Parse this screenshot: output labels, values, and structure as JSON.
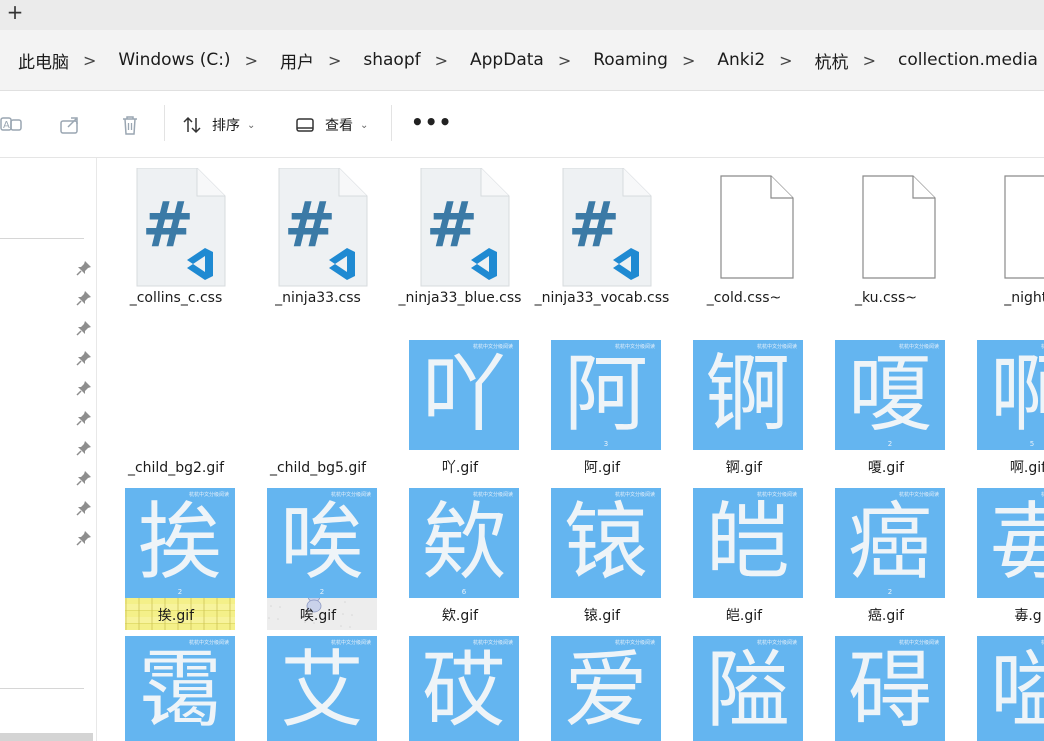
{
  "tabstrip": {
    "new_tab_glyph": "+"
  },
  "breadcrumb": [
    "此电脑",
    "Windows (C:)",
    "用户",
    "shaopf",
    "AppData",
    "Roaming",
    "Anki2",
    "杭杭",
    "collection.media"
  ],
  "breadcrumb_separator": ">",
  "toolbar": {
    "sort_label": "排序",
    "view_label": "查看",
    "more_label": "•••",
    "chevron": "⌄"
  },
  "files": [
    {
      "name": "_collins_c.css",
      "kind": "css-vscode"
    },
    {
      "name": "_ninja33.css",
      "kind": "css-vscode"
    },
    {
      "name": "_ninja33_blue.css",
      "kind": "css-vscode"
    },
    {
      "name": "_ninja33_vocab.css",
      "kind": "css-vscode"
    },
    {
      "name": "_cold.css~",
      "kind": "blank"
    },
    {
      "name": "_ku.css~",
      "kind": "blank"
    },
    {
      "name": "_night.",
      "kind": "blank"
    },
    {
      "name": "_child_bg2.gif",
      "kind": "bg-yellow"
    },
    {
      "name": "_child_bg5.gif",
      "kind": "bg-grey"
    },
    {
      "name": "吖.gif",
      "kind": "gif",
      "glyph": "吖",
      "stroke": ""
    },
    {
      "name": "阿.gif",
      "kind": "gif",
      "glyph": "阿",
      "stroke": "3"
    },
    {
      "name": "锕.gif",
      "kind": "gif",
      "glyph": "锕",
      "stroke": ""
    },
    {
      "name": "嗄.gif",
      "kind": "gif",
      "glyph": "嗄",
      "stroke": "2"
    },
    {
      "name": "啊.gif",
      "kind": "gif",
      "glyph": "啊",
      "stroke": "5"
    },
    {
      "name": "挨.gif",
      "kind": "gif",
      "glyph": "挨",
      "stroke": "2"
    },
    {
      "name": "唉.gif",
      "kind": "gif",
      "glyph": "唉",
      "stroke": "2"
    },
    {
      "name": "欸.gif",
      "kind": "gif",
      "glyph": "欸",
      "stroke": "6"
    },
    {
      "name": "锿.gif",
      "kind": "gif",
      "glyph": "锿",
      "stroke": ""
    },
    {
      "name": "皑.gif",
      "kind": "gif",
      "glyph": "皑",
      "stroke": ""
    },
    {
      "name": "癌.gif",
      "kind": "gif",
      "glyph": "癌",
      "stroke": "2"
    },
    {
      "name": "毐.g",
      "kind": "gif",
      "glyph": "毐",
      "stroke": ""
    },
    {
      "name": "",
      "kind": "gif",
      "glyph": "霭",
      "stroke": ""
    },
    {
      "name": "",
      "kind": "gif",
      "glyph": "艾",
      "stroke": ""
    },
    {
      "name": "",
      "kind": "gif",
      "glyph": "砹",
      "stroke": ""
    },
    {
      "name": "",
      "kind": "gif",
      "glyph": "爱",
      "stroke": ""
    },
    {
      "name": "",
      "kind": "gif",
      "glyph": "隘",
      "stroke": ""
    },
    {
      "name": "",
      "kind": "gif",
      "glyph": "碍",
      "stroke": ""
    },
    {
      "name": "",
      "kind": "gif",
      "glyph": "嗌",
      "stroke": ""
    }
  ],
  "gif_watermark": "杭杭中文分级阅读",
  "colors": {
    "gif_tile": "#64b5f0",
    "vscode_hash": "#3b7aa6",
    "vscode_badge": "#1f8ad2",
    "toolbar_icon": "#8a8a8a"
  },
  "icons": [
    "translate-icon",
    "share-icon",
    "delete-icon",
    "sort-icon",
    "view-icon",
    "pin-icon",
    "vscode-icon",
    "blank-file-icon"
  ]
}
